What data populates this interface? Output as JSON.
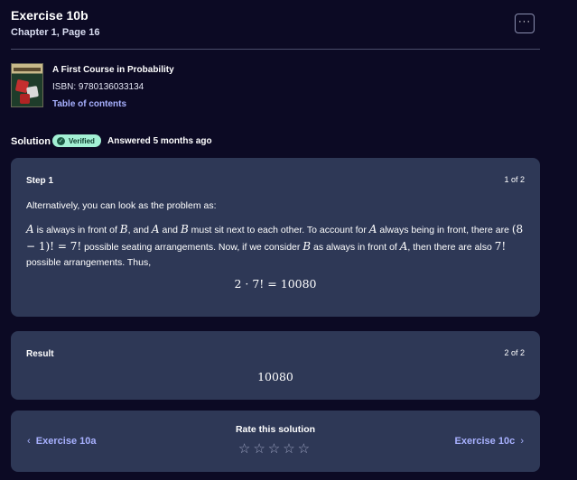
{
  "header": {
    "title": "Exercise 10b",
    "subtitle": "Chapter 1, Page 16",
    "more_label": "···"
  },
  "book": {
    "title": "A First Course in Probability",
    "isbn": "ISBN: 9780136033134",
    "toc_link": "Table of contents"
  },
  "solution": {
    "label": "Solution",
    "verified_badge": "Verified",
    "answered": "Answered 5 months ago"
  },
  "step": {
    "title": "Step 1",
    "count": "1 of 2",
    "intro": "Alternatively, you can look as the problem as:",
    "body": {
      "A": "A",
      "B": "B",
      "t1": " is always in front of ",
      "t2": ", and ",
      "t3": " and ",
      "t4": " must sit next to each other. To account for ",
      "t5": " always being in front, there are ",
      "expr1": "(8 − 1)! = 7!",
      "t6": " possible seating arrangements. Now, if we consider ",
      "t7": " as always in front of ",
      "t8": ", then there are also ",
      "expr2": "7!",
      "t9": " possible arrangements. Thus,"
    },
    "formula": "2 · 7! = 10080"
  },
  "result": {
    "title": "Result",
    "count": "2 of 2",
    "value": "10080"
  },
  "nav": {
    "prev_label": "Exercise 10a",
    "next_label": "Exercise 10c",
    "rate_label": "Rate this solution",
    "star_count": 5,
    "rating": 0
  },
  "colors": {
    "background": "#0c0a24",
    "card": "#2e3856",
    "accent": "#a8b1ff",
    "verified": "#a3f0d4"
  }
}
